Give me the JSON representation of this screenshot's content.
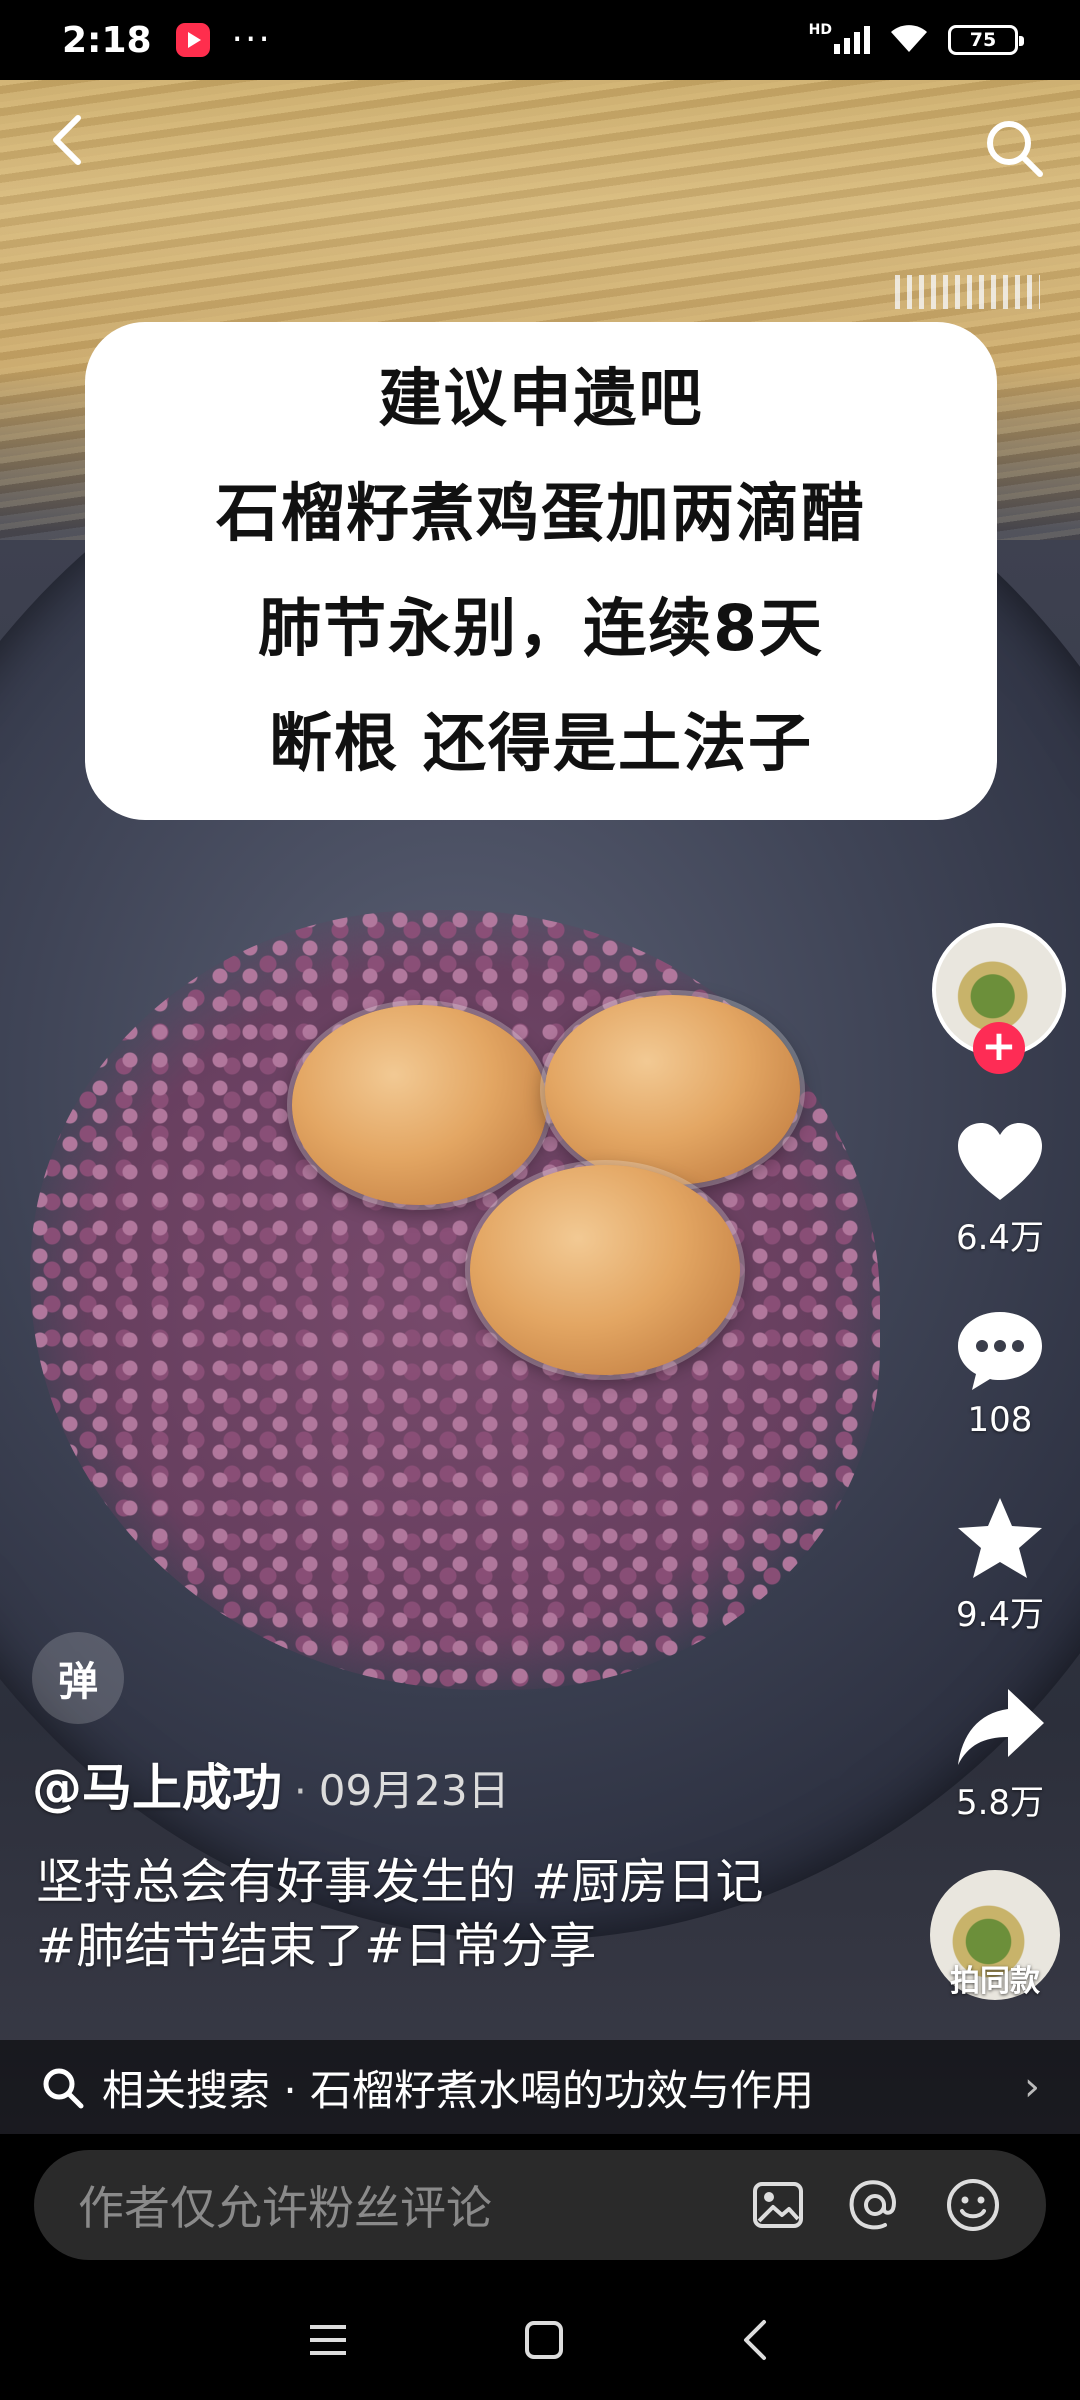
{
  "status_bar": {
    "time": "2:18",
    "dots": "···",
    "network": "HD",
    "battery": "75"
  },
  "video": {
    "caption_lines": [
      "建议申遗吧",
      "石榴籽煮鸡蛋加两滴醋",
      "肺节永别，连续8天",
      "断根 还得是土法子"
    ]
  },
  "actions": {
    "likes": "6.4万",
    "comments": "108",
    "favorites": "9.4万",
    "shares": "5.8万",
    "music_label": "拍同款",
    "follow_symbol": "+"
  },
  "post": {
    "danmu": "弹",
    "author": "@马上成功",
    "separator": "·",
    "date": "09月23日",
    "description": "坚持总会有好事发生的 #厨房日记 #肺结节结束了#日常分享"
  },
  "related": {
    "text": "相关搜索 · 石榴籽煮水喝的功效与作用",
    "arrow": "›"
  },
  "comment": {
    "placeholder": "作者仅允许粉丝评论"
  },
  "colors": {
    "accent": "#fe2c55",
    "background": "#000000"
  }
}
